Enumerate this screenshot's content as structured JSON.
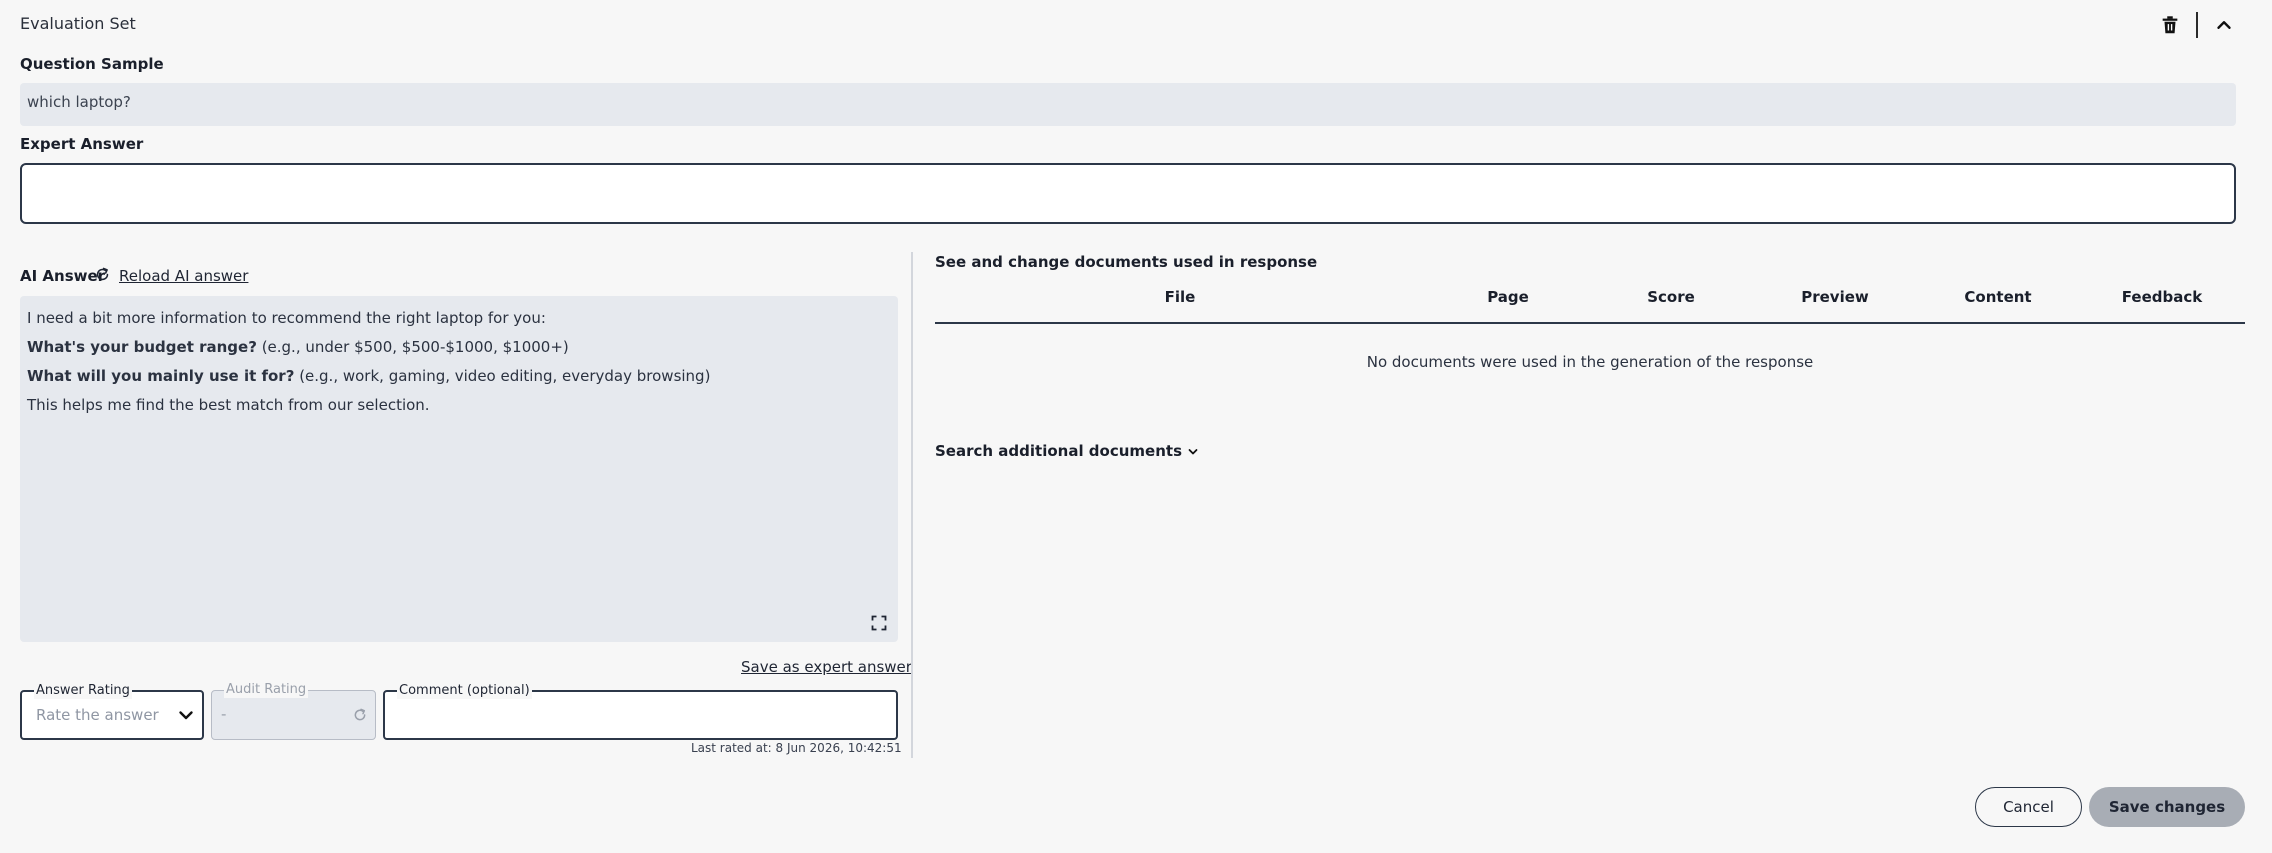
{
  "header": {
    "title": "Evaluation Set",
    "delete_icon": "trash-icon",
    "collapse_icon": "chevron-up-icon"
  },
  "question": {
    "label": "Question Sample",
    "value": "which laptop?"
  },
  "expert": {
    "label": "Expert Answer",
    "value": ""
  },
  "ai": {
    "label": "AI Answer",
    "reload_label": "Reload AI answer",
    "lines": [
      {
        "bold": "",
        "text": "I need a bit more information to recommend the right laptop for you:"
      },
      {
        "bold": "What's your budget range?",
        "text": " (e.g., under $500, $500-$1000, $1000+)"
      },
      {
        "bold": "What will you mainly use it for?",
        "text": " (e.g., work, gaming, video editing, everyday browsing)"
      },
      {
        "bold": "",
        "text": "This helps me find the best match from our selection."
      }
    ],
    "save_expert_label": "Save as expert answer"
  },
  "rating": {
    "answer_label": "Answer Rating",
    "answer_placeholder": "Rate the answer",
    "audit_label": "Audit Rating",
    "audit_value": "-",
    "comment_label": "Comment (optional)",
    "last_rated": "Last rated at: 8 Jun 2026, 10:42:51"
  },
  "documents": {
    "title": "See and change documents used in response",
    "columns": [
      "File",
      "Page",
      "Score",
      "Preview",
      "Content",
      "Feedback"
    ],
    "empty_message": "No documents were used in the generation of the response",
    "search_label": "Search additional documents"
  },
  "actions": {
    "cancel": "Cancel",
    "save": "Save changes"
  }
}
